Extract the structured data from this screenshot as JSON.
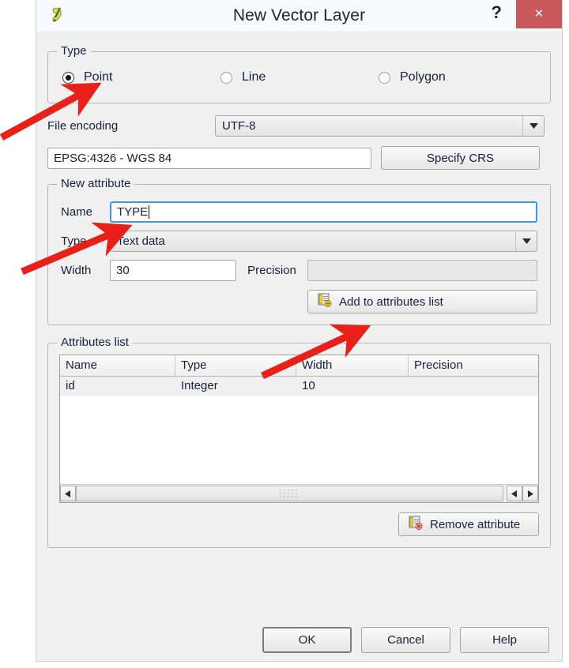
{
  "window": {
    "title": "New Vector Layer",
    "app_icon": "qgis-icon",
    "help_button": "?",
    "close_button": "×",
    "close_button_color": "#c9585d"
  },
  "type_group": {
    "legend": "Type",
    "options": [
      {
        "label": "Point",
        "selected": true
      },
      {
        "label": "Line",
        "selected": false
      },
      {
        "label": "Polygon",
        "selected": false
      }
    ]
  },
  "encoding": {
    "label": "File encoding",
    "value": "UTF-8"
  },
  "crs": {
    "value": "EPSG:4326 - WGS 84",
    "button": "Specify CRS"
  },
  "new_attribute": {
    "legend": "New attribute",
    "name_label": "Name",
    "name_value": "TYPE",
    "type_label": "Type",
    "type_value": "Text data",
    "width_label": "Width",
    "width_value": "30",
    "precision_label": "Precision",
    "precision_value": "",
    "add_button": "Add to attributes list",
    "add_button_icon": "add-attribute-icon"
  },
  "attributes_list": {
    "legend": "Attributes list",
    "columns": [
      "Name",
      "Type",
      "Width",
      "Precision"
    ],
    "rows": [
      {
        "name": "id",
        "type": "Integer",
        "width": "10",
        "precision": ""
      }
    ],
    "remove_button": "Remove attribute",
    "remove_button_icon": "remove-attribute-icon"
  },
  "footer": {
    "ok": "OK",
    "cancel": "Cancel",
    "help": "Help"
  },
  "annotations": {
    "arrow_color": "#e8201a",
    "arrows": [
      {
        "name": "arrow-to-point-radio",
        "from": [
          2,
          174
        ],
        "to": [
          112,
          114
        ]
      },
      {
        "name": "arrow-to-name-field",
        "from": [
          28,
          344
        ],
        "to": [
          150,
          292
        ]
      },
      {
        "name": "arrow-to-add-button",
        "from": [
          332,
          476
        ],
        "to": [
          452,
          420
        ]
      }
    ]
  }
}
